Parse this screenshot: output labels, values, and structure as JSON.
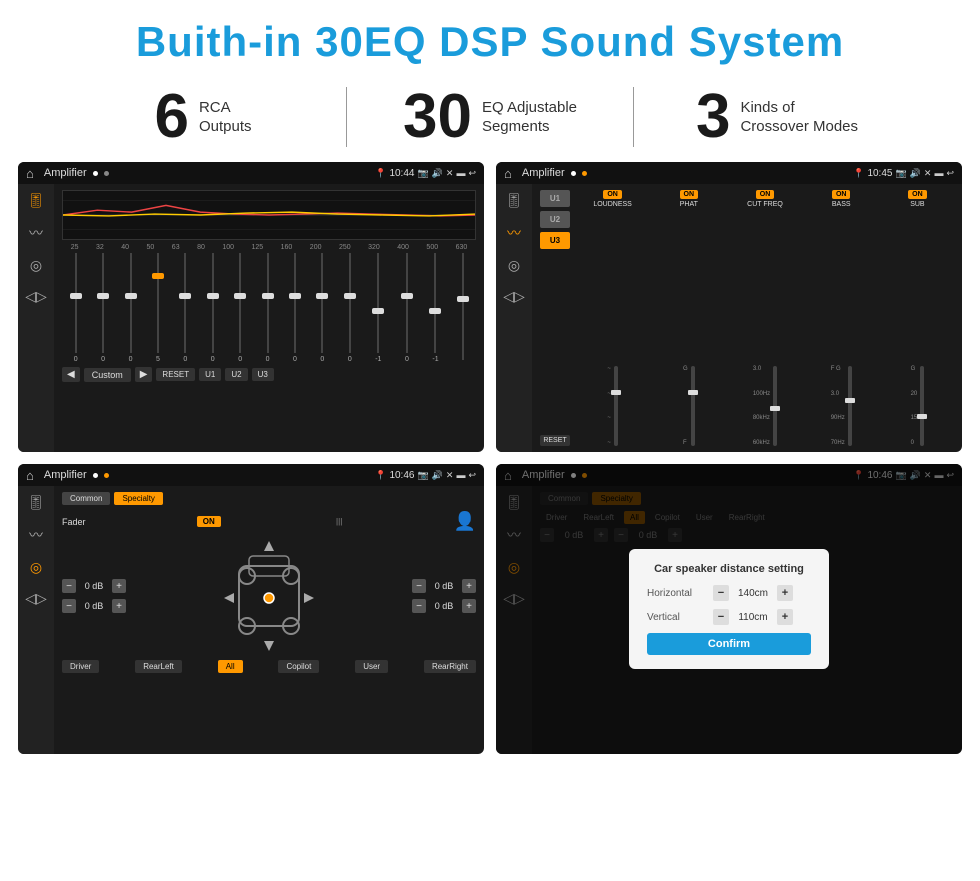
{
  "header": {
    "title": "Buith-in 30EQ DSP Sound System"
  },
  "stats": [
    {
      "number": "6",
      "line1": "RCA",
      "line2": "Outputs"
    },
    {
      "number": "30",
      "line1": "EQ Adjustable",
      "line2": "Segments"
    },
    {
      "number": "3",
      "line1": "Kinds of",
      "line2": "Crossover Modes"
    }
  ],
  "screens": {
    "eq": {
      "app": "Amplifier",
      "time": "10:44",
      "eq_bands": [
        "25",
        "32",
        "40",
        "50",
        "63",
        "80",
        "100",
        "125",
        "160",
        "200",
        "250",
        "320",
        "400",
        "500",
        "630"
      ],
      "eq_values": [
        "0",
        "0",
        "0",
        "5",
        "0",
        "0",
        "0",
        "0",
        "0",
        "0",
        "0",
        "-1",
        "0",
        "-1"
      ],
      "preset": "Custom",
      "buttons": [
        "RESET",
        "U1",
        "U2",
        "U3"
      ]
    },
    "crossover": {
      "app": "Amplifier",
      "time": "10:45",
      "units": [
        "U1",
        "U2",
        "U3"
      ],
      "channels": [
        "LOUDNESS",
        "PHAT",
        "CUT FREQ",
        "BASS",
        "SUB"
      ],
      "reset": "RESET"
    },
    "fader": {
      "app": "Amplifier",
      "time": "10:46",
      "tabs": [
        "Common",
        "Specialty"
      ],
      "fader_label": "Fader",
      "on": "ON",
      "db_values": [
        "0 dB",
        "0 dB",
        "0 dB",
        "0 dB"
      ],
      "buttons": [
        "Driver",
        "RearLeft",
        "All",
        "Copilot",
        "User",
        "RearRight"
      ]
    },
    "dialog": {
      "app": "Amplifier",
      "time": "10:46",
      "tabs": [
        "Common",
        "Specialty"
      ],
      "dialog_title": "Car speaker distance setting",
      "horizontal_label": "Horizontal",
      "horizontal_value": "140cm",
      "vertical_label": "Vertical",
      "vertical_value": "110cm",
      "confirm_label": "Confirm",
      "buttons": [
        "Driver",
        "RearLeft",
        "All",
        "Copilot",
        "User",
        "RearRight"
      ],
      "db_values": [
        "0 dB",
        "0 dB"
      ]
    }
  }
}
